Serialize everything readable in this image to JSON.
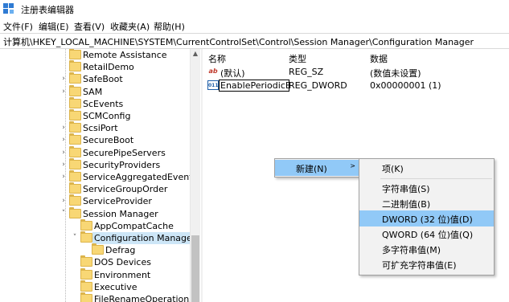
{
  "window": {
    "title": "注册表编辑器"
  },
  "menu": [
    "文件(F)",
    "编辑(E)",
    "查看(V)",
    "收藏夹(A)",
    "帮助(H)"
  ],
  "address": "计算机\\HKEY_LOCAL_MACHINE\\SYSTEM\\CurrentControlSet\\Control\\Session Manager\\Configuration Manager",
  "tree": {
    "items": [
      {
        "label": "Remote Assistance",
        "chevron": "",
        "depth": 0
      },
      {
        "label": "RetailDemo",
        "chevron": "",
        "depth": 0
      },
      {
        "label": "SafeBoot",
        "chevron": ">",
        "depth": 0
      },
      {
        "label": "SAM",
        "chevron": ">",
        "depth": 0
      },
      {
        "label": "ScEvents",
        "chevron": "",
        "depth": 0
      },
      {
        "label": "SCMConfig",
        "chevron": "",
        "depth": 0
      },
      {
        "label": "ScsiPort",
        "chevron": ">",
        "depth": 0
      },
      {
        "label": "SecureBoot",
        "chevron": ">",
        "depth": 0
      },
      {
        "label": "SecurePipeServers",
        "chevron": ">",
        "depth": 0
      },
      {
        "label": "SecurityProviders",
        "chevron": ">",
        "depth": 0
      },
      {
        "label": "ServiceAggregatedEvents",
        "chevron": ">",
        "depth": 0
      },
      {
        "label": "ServiceGroupOrder",
        "chevron": "",
        "depth": 0
      },
      {
        "label": "ServiceProvider",
        "chevron": ">",
        "depth": 0
      },
      {
        "label": "Session Manager",
        "chevron": "v",
        "depth": 0
      },
      {
        "label": "AppCompatCache",
        "chevron": "",
        "depth": 1
      },
      {
        "label": "Configuration Manager",
        "chevron": "v",
        "depth": 1,
        "selected": true
      },
      {
        "label": "Defrag",
        "chevron": "",
        "depth": 2
      },
      {
        "label": "DOS Devices",
        "chevron": "",
        "depth": 1
      },
      {
        "label": "Environment",
        "chevron": "",
        "depth": 1
      },
      {
        "label": "Executive",
        "chevron": "",
        "depth": 1
      },
      {
        "label": "FileRenameOperations",
        "chevron": "",
        "depth": 1
      }
    ]
  },
  "list": {
    "columns": [
      "名称",
      "类型",
      "数据"
    ],
    "rows": [
      {
        "icon": "ab",
        "icon_kind": "sz",
        "name": "(默认)",
        "type": "REG_SZ",
        "data": "(数值未设置)"
      },
      {
        "icon": "011",
        "icon_kind": "dword",
        "name": "EnablePeriodicB...",
        "type": "REG_DWORD",
        "data": "0x00000001 (1)"
      }
    ]
  },
  "context_menu": {
    "new_label": "新建(N)",
    "arrow": ">",
    "submenu": [
      {
        "label": "项(K)"
      },
      {
        "label": "字符串值(S)"
      },
      {
        "label": "二进制值(B)"
      },
      {
        "label": "DWORD (32 位)值(D)",
        "highlighted": true
      },
      {
        "label": "QWORD (64 位)值(Q)"
      },
      {
        "label": "多字符串值(M)"
      },
      {
        "label": "可扩充字符串值(E)"
      }
    ]
  },
  "colors": {
    "selection": "#cde6f7",
    "menu_highlight": "#91c9f7",
    "folder": "#f8d775"
  }
}
